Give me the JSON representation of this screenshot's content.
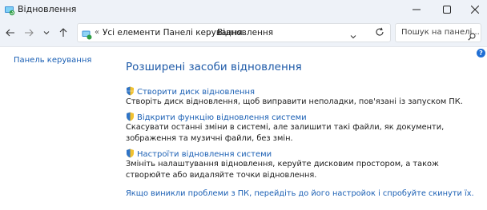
{
  "window": {
    "title": "Відновлення",
    "controls": {
      "minimize": "minimize-icon",
      "maximize": "maximize-icon",
      "close": "close-icon"
    }
  },
  "nav": {
    "back": "arrow-left-icon",
    "forward": "arrow-right-icon",
    "recent": "chevron-down-icon",
    "up": "arrow-up-icon"
  },
  "address": {
    "overflow": "«",
    "crumbs": [
      "Усі елементи Панелі керування",
      "Відновлення"
    ],
    "separator": "›"
  },
  "search": {
    "placeholder": "Пошук на панелі..."
  },
  "sidebar": {
    "link": "Панель керування"
  },
  "main": {
    "title": "Розширені засоби відновлення",
    "tasks": [
      {
        "link": "Створити диск відновлення",
        "desc": "Створіть диск відновлення, щоб виправити неполадки, пов'язані із запуском ПК."
      },
      {
        "link": "Відкрити функцію відновлення системи",
        "desc": "Скасувати останні зміни в системі, але залишити такі файли, як документи, зображення та музичні файли, без змін."
      },
      {
        "link": "Настроїти відновлення системи",
        "desc": "Змініть налаштування відновлення, керуйте дисковим простором, а також створюйте або видаляйте точки відновлення."
      }
    ],
    "footer_link": "Якщо виникли проблеми з ПК, перейдіть до його настройок і спробуйте скинути їх."
  }
}
